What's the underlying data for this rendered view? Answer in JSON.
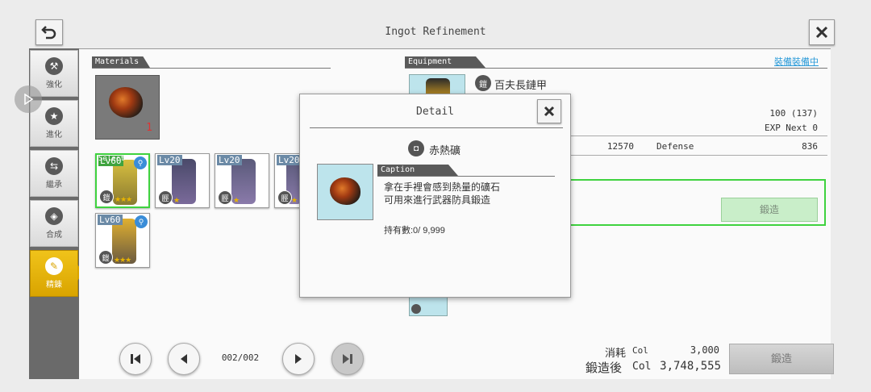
{
  "header": {
    "title": "Ingot Refinement"
  },
  "sidebar": {
    "items": [
      {
        "label": "強化",
        "icon": "hammer-icon"
      },
      {
        "label": "進化",
        "icon": "star-icon"
      },
      {
        "label": "繼承",
        "icon": "transfer-icon"
      },
      {
        "label": "合成",
        "icon": "combine-icon"
      },
      {
        "label": "精錬",
        "icon": "refine-icon",
        "active": true
      }
    ]
  },
  "materials": {
    "heading": "Materials",
    "slot_count": "1",
    "cards": [
      {
        "level": "Lv60",
        "select": "Select",
        "stars": "★★★"
      },
      {
        "level": "Lv20",
        "stars": "★"
      },
      {
        "level": "Lv20",
        "stars": "★"
      },
      {
        "level": "Lv20",
        "stars": "★"
      },
      {
        "level": "Lv60",
        "stars": "★★★"
      }
    ]
  },
  "equipment": {
    "heading": "Equipment",
    "status_link": "裝備裝備中",
    "name": "百夫長鏈甲",
    "level_value": "100 (137)",
    "exp_label": "EXP",
    "next_label": "Next 0",
    "stat_value": "12570",
    "defense_label": "Defense",
    "defense_value": "836",
    "forge_label": "鍛造"
  },
  "pagination": {
    "page": "002/002"
  },
  "cost": {
    "consume_label": "消耗",
    "consume_unit": "Col",
    "consume_value": "3,000",
    "after_label": "鍛造後",
    "after_unit": "Col",
    "after_value": "3,748,555",
    "forge_button": "鍛造"
  },
  "dialog": {
    "title": "Detail",
    "item_name": "赤熱礦",
    "caption_heading": "Caption",
    "caption_line1": "拿在手裡會感到熱量的礦石",
    "caption_line2": "可用來進行武器防具鍛造",
    "owned": "持有數:0/ 9,999"
  }
}
